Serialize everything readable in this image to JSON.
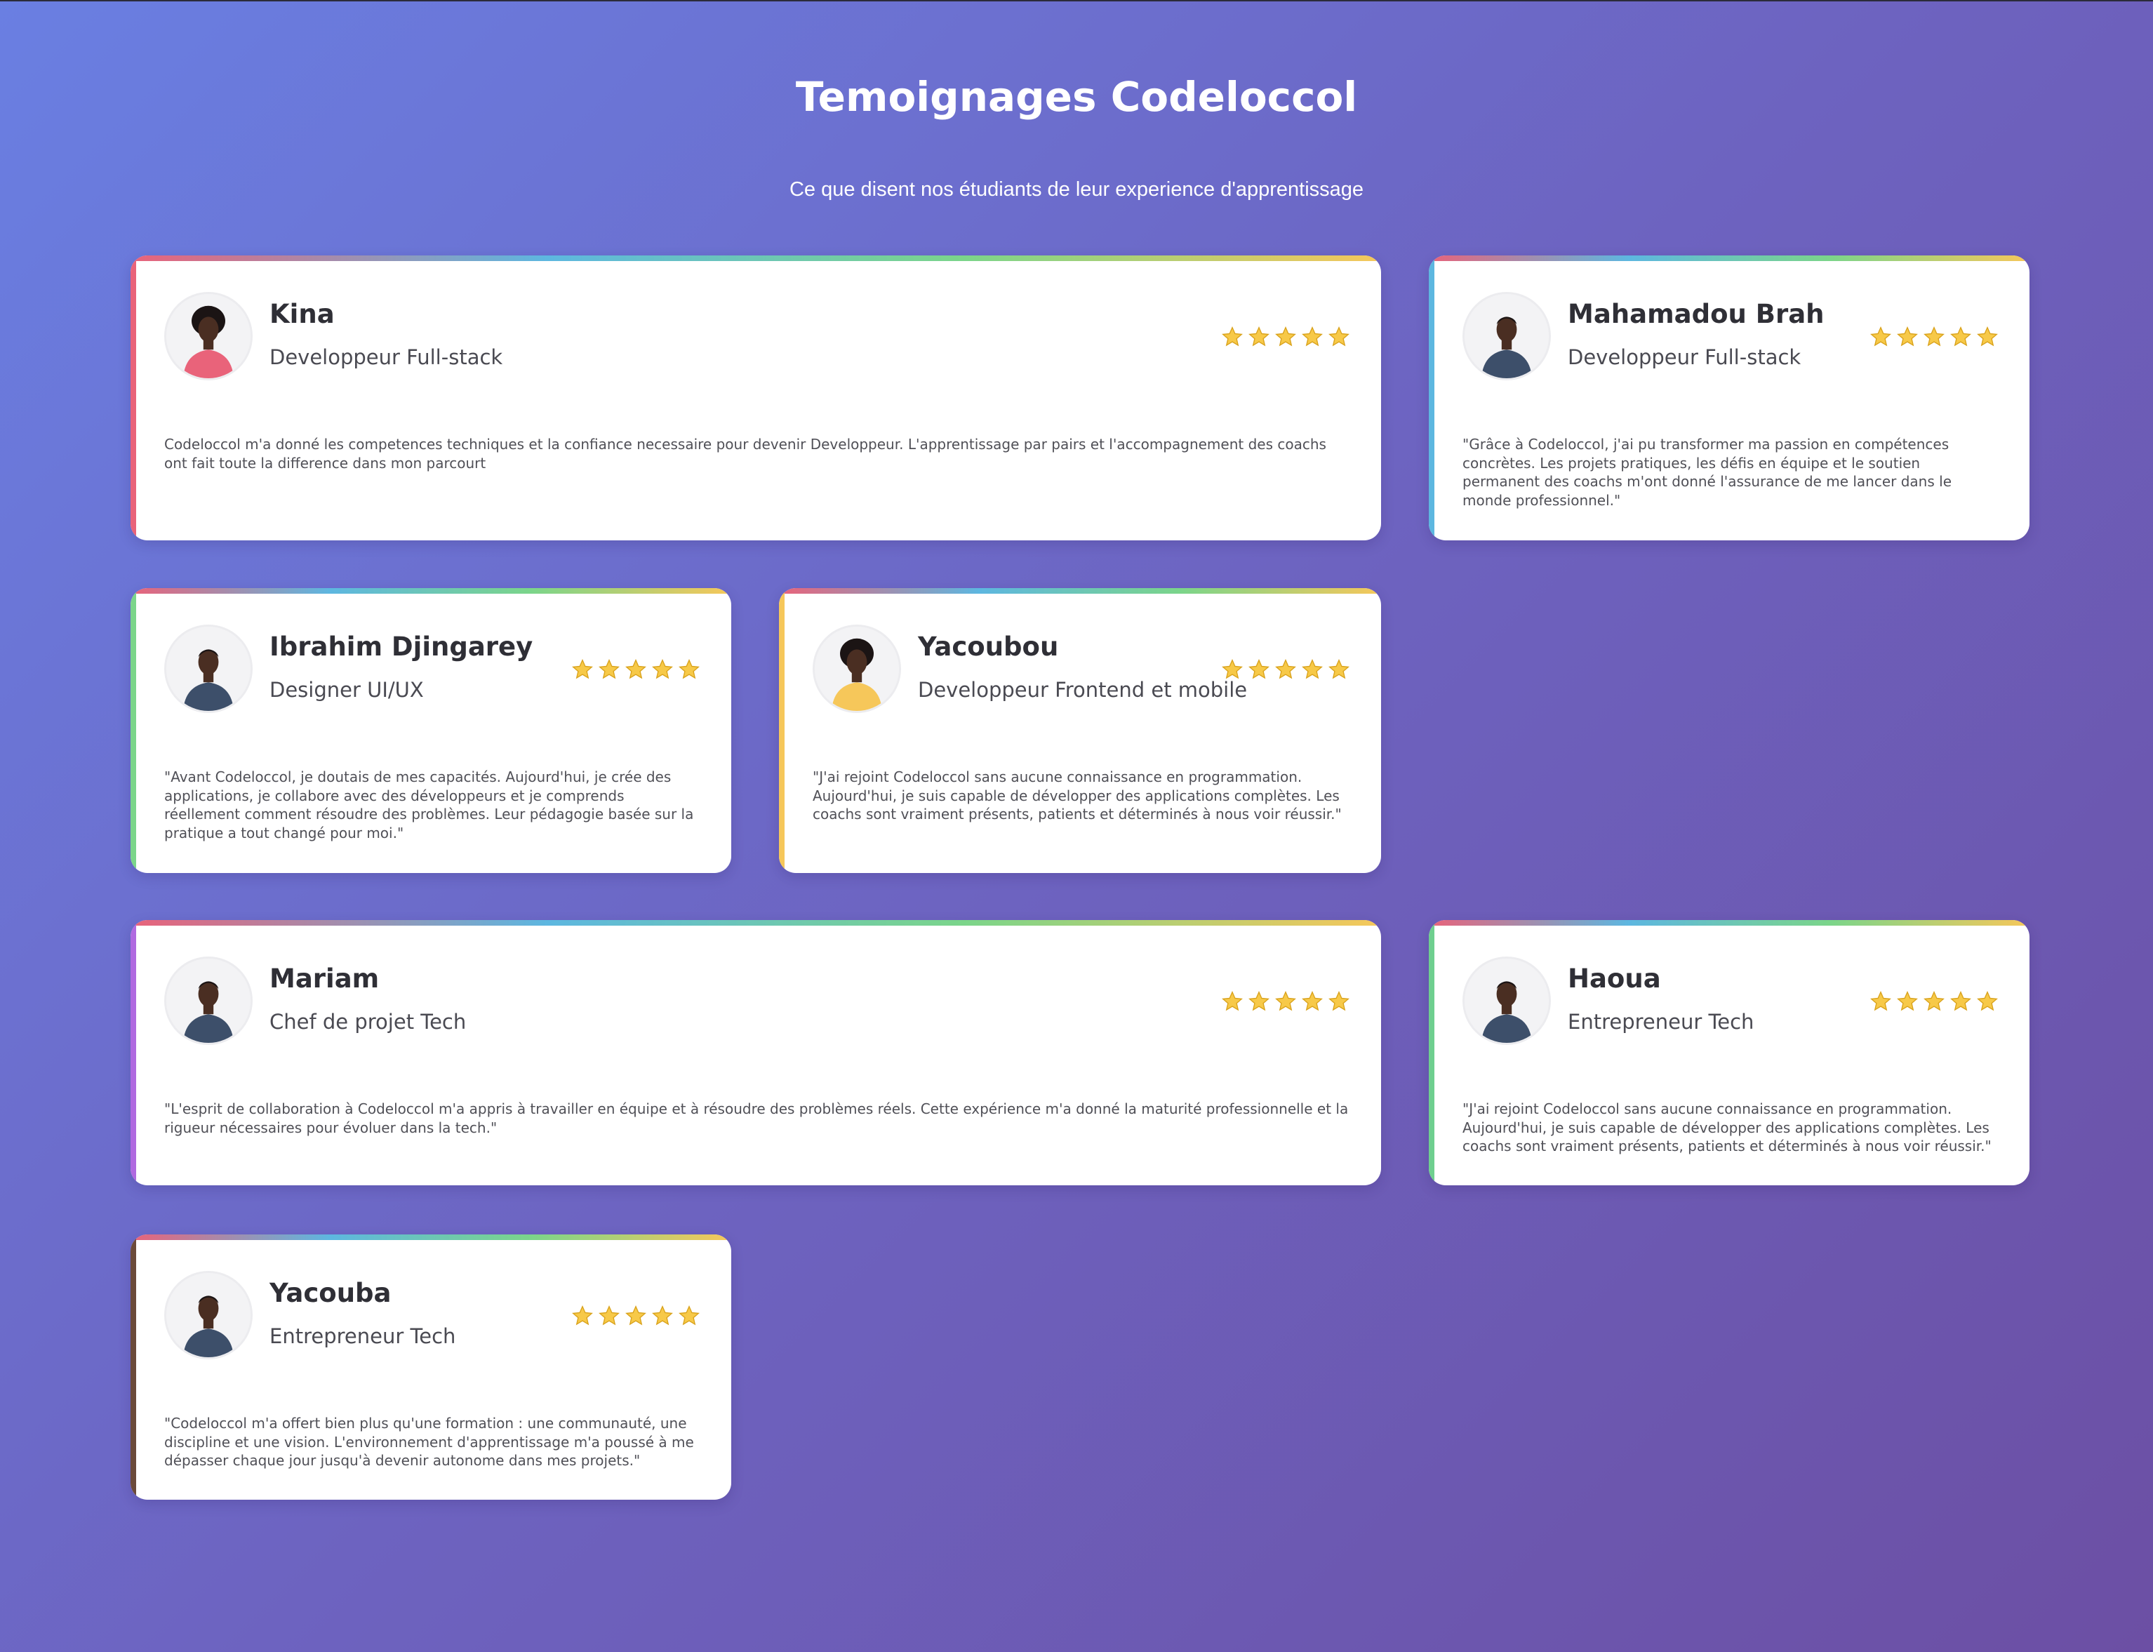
{
  "page": {
    "title": "Temoignages Codeloccol",
    "subtitle": "Ce que disent nos étudiants de leur experience d'apprentissage"
  },
  "colors": {
    "background_start": "#6a7fe2",
    "background_end": "#6c4fa4",
    "card_background": "#ffffff",
    "star": "#f7c948",
    "gradient_stops": [
      "#e9637a",
      "#5db7e0",
      "#7bd58a",
      "#f6c75a"
    ]
  },
  "testimonials": [
    {
      "name": "Kina",
      "role": "Developpeur Full-stack",
      "rating": 5,
      "rating_max": 5,
      "quote": "Codeloccol m'a donné les competences techniques et la confiance necessaire pour devenir Developpeur. L'apprentissage par pairs et l'accompagnement des coachs ont fait toute la difference dans mon parcourt",
      "avatar_icon": "woman-portrait",
      "accent": "#e9637a"
    },
    {
      "name": "Mahamadou Brah",
      "role": "Developpeur Full-stack",
      "rating": 5,
      "rating_max": 5,
      "quote": "\"Grâce à Codeloccol, j'ai pu transformer ma passion en compétences concrètes. Les projets pratiques, les défis en équipe et le soutien permanent des coachs m'ont donné l'assurance de me lancer dans le monde professionnel.\"",
      "avatar_icon": "man-portrait",
      "accent": "#5db7e0"
    },
    {
      "name": "Ibrahim Djingarey",
      "role": "Designer UI/UX",
      "rating": 5,
      "rating_max": 5,
      "quote": "\"Avant Codeloccol, je doutais de mes capacités. Aujourd'hui, je crée des applications, je collabore avec des développeurs et je comprends réellement comment résoudre des problèmes. Leur pédagogie basée sur la pratique a tout changé pour moi.\"",
      "avatar_icon": "man-portrait",
      "accent": "#7bd58a"
    },
    {
      "name": "Yacoubou",
      "role": "Developpeur Frontend et mobile",
      "rating": 5,
      "rating_max": 5,
      "quote": "\"J'ai rejoint Codeloccol sans aucune connaissance en programmation. Aujourd'hui, je suis capable de développer des applications complètes. Les coachs sont vraiment présents, patients et déterminés à nous voir réussir.\"",
      "avatar_icon": "woman-portrait",
      "accent": "#f6c75a"
    },
    {
      "name": "Mariam",
      "role": "Chef de projet Tech",
      "rating": 5,
      "rating_max": 5,
      "quote": "\"L'esprit de collaboration à Codeloccol m'a appris à travailler en équipe et à résoudre des problèmes réels. Cette expérience m'a donné la maturité professionnelle et la rigueur nécessaires pour évoluer dans la tech.\"",
      "avatar_icon": "man-portrait",
      "accent": "#b069e0"
    },
    {
      "name": "Haoua",
      "role": "Entrepreneur Tech",
      "rating": 5,
      "rating_max": 5,
      "quote": "\"J'ai rejoint Codeloccol sans aucune connaissance en programmation. Aujourd'hui, je suis capable de développer des applications complètes. Les coachs sont vraiment présents, patients et déterminés à nous voir réussir.\"",
      "avatar_icon": "man-portrait",
      "accent": "#6fcf8f"
    },
    {
      "name": "Yacouba",
      "role": "Entrepreneur Tech",
      "rating": 5,
      "rating_max": 5,
      "quote": "\"Codeloccol m'a offert bien plus qu'une formation : une communauté, une discipline et une vision. L'environnement d'apprentissage m'a poussé à me dépasser chaque jour jusqu'à devenir autonome dans mes projets.\"",
      "avatar_icon": "man-portrait",
      "accent": "#6b4a3a"
    }
  ]
}
